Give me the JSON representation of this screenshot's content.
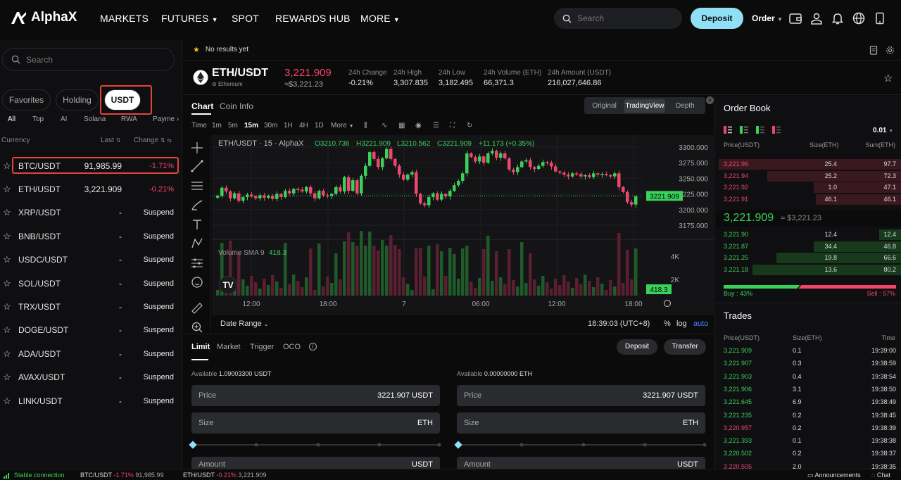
{
  "app": {
    "name": "AlphaX"
  },
  "nav": {
    "markets": "MARKETS",
    "futures": "FUTURES",
    "spot": "SPOT",
    "rewards": "REWARDS HUB",
    "more": "MORE",
    "search_placeholder": "Search",
    "deposit": "Deposit",
    "order": "Order"
  },
  "sidebar": {
    "search_placeholder": "Search",
    "pills": [
      "Favorites",
      "Holding",
      "USDT"
    ],
    "categories": [
      "All",
      "Top",
      "AI",
      "Solana",
      "RWA",
      "Payme"
    ],
    "col_currency": "Currency",
    "col_last": "Last",
    "col_change": "Change",
    "rows": [
      {
        "sym": "BTC/USDT",
        "last": "91,985.99",
        "change": "-1.71%"
      },
      {
        "sym": "ETH/USDT",
        "last": "3,221.909",
        "change": "-0.21%"
      },
      {
        "sym": "XRP/USDT",
        "last": "-",
        "change": "Suspend"
      },
      {
        "sym": "BNB/USDT",
        "last": "-",
        "change": "Suspend"
      },
      {
        "sym": "USDC/USDT",
        "last": "-",
        "change": "Suspend"
      },
      {
        "sym": "SOL/USDT",
        "last": "-",
        "change": "Suspend"
      },
      {
        "sym": "TRX/USDT",
        "last": "-",
        "change": "Suspend"
      },
      {
        "sym": "DOGE/USDT",
        "last": "-",
        "change": "Suspend"
      },
      {
        "sym": "ADA/USDT",
        "last": "-",
        "change": "Suspend"
      },
      {
        "sym": "AVAX/USDT",
        "last": "-",
        "change": "Suspend"
      },
      {
        "sym": "LINK/USDT",
        "last": "-",
        "change": "Suspend"
      }
    ]
  },
  "notice": {
    "text": "No results yet"
  },
  "ticker": {
    "pair": "ETH/USDT",
    "coin": "Ethereum",
    "price": "3,221.909",
    "price_fiat": "≈$3,221.23",
    "change_label": "24h Change",
    "change": "-0.21%",
    "high_label": "24h High",
    "high": "3,307.835",
    "low_label": "24h Low",
    "low": "3,182.495",
    "vol_label": "24h Volume (ETH)",
    "vol": "66,371.3",
    "amt_label": "24h Amount (USDT)",
    "amt": "216,027,646.86"
  },
  "chart_tabs": {
    "chart": "Chart",
    "coin_info": "Coin Info"
  },
  "view_modes": [
    "Original",
    "TradingView",
    "Depth"
  ],
  "timeframes": [
    "Time",
    "1m",
    "5m",
    "15m",
    "30m",
    "1H",
    "4H",
    "1D",
    "More"
  ],
  "chart": {
    "legend_pair": "ETH/USDT · 15 · AlphaX",
    "o": "O3210.736",
    "h": "H3221.909",
    "l": "L3210.562",
    "c": "C3221.909",
    "chg": "+11.173 (+0.35%)",
    "volume_label": "Volume SMA 9",
    "volume_val": "418.3",
    "price_ticks": [
      "3300.000",
      "3275.000",
      "3250.000",
      "3225.000",
      "3200.000",
      "3175.000"
    ],
    "last_tag": "3221.909",
    "vol_ticks": [
      "4K",
      "2K"
    ],
    "vol_tag": "418.3",
    "time_ticks": [
      "12:00",
      "18:00",
      "7",
      "06:00",
      "12:00",
      "18:00"
    ],
    "date_range": "Date Range",
    "clock": "18:39:03 (UTC+8)",
    "pct": "%",
    "log": "log",
    "auto": "auto"
  },
  "chart_data": {
    "type": "candlestick",
    "ylim": [
      3175,
      3300
    ],
    "last": 3221.909
  },
  "trade": {
    "tabs": [
      "Limit",
      "Market",
      "Trigger",
      "OCO"
    ],
    "deposit": "Deposit",
    "transfer": "Transfer",
    "buy_available_label": "Available",
    "buy_available": "1.09003300 USDT",
    "sell_available_label": "Available",
    "sell_available": "0.00000000 ETH",
    "price_label": "Price",
    "buy_price": "3221.907",
    "sell_price": "3221.907",
    "price_unit": "USDT",
    "size_label": "Size",
    "size_unit": "ETH",
    "amount_label": "Amount",
    "amount_unit": "USDT"
  },
  "orderbook": {
    "title": "Order Book",
    "tick": "0.01",
    "col_price": "Price(USDT)",
    "col_size": "Size(ETH)",
    "col_sum": "Sum(ETH)",
    "asks": [
      {
        "p": "3,221.96",
        "s": "25.4",
        "sum": "97.7",
        "depth": 0.98
      },
      {
        "p": "3,221.94",
        "s": "25.2",
        "sum": "72.3",
        "depth": 0.72
      },
      {
        "p": "3,221.92",
        "s": "1.0",
        "sum": "47.1",
        "depth": 0.47
      },
      {
        "p": "3,221.91",
        "s": "46.1",
        "sum": "46.1",
        "depth": 0.46
      }
    ],
    "mid": "3,221.909",
    "mid_fiat": "≈ $3,221.23",
    "bids": [
      {
        "p": "3,221.90",
        "s": "12.4",
        "sum": "12.4",
        "depth": 0.12
      },
      {
        "p": "3,221.87",
        "s": "34.4",
        "sum": "46.8",
        "depth": 0.47
      },
      {
        "p": "3,221.25",
        "s": "19.8",
        "sum": "66.6",
        "depth": 0.67
      },
      {
        "p": "3,221.18",
        "s": "13.6",
        "sum": "80.2",
        "depth": 0.8
      }
    ],
    "buy_label": "Buy : 43%",
    "sell_label": "Sell : 57%",
    "buy_pct": 0.43
  },
  "trades": {
    "title": "Trades",
    "col_price": "Price(USDT)",
    "col_size": "Size(ETH)",
    "col_time": "Time",
    "rows": [
      {
        "p": "3,221.909",
        "s": "0.1",
        "t": "19:39:00",
        "side": "buy"
      },
      {
        "p": "3,221.907",
        "s": "0.3",
        "t": "19:38:59",
        "side": "buy"
      },
      {
        "p": "3,221.903",
        "s": "0.4",
        "t": "19:38:54",
        "side": "buy"
      },
      {
        "p": "3,221.906",
        "s": "3.1",
        "t": "19:38:50",
        "side": "buy"
      },
      {
        "p": "3,221.645",
        "s": "6.9",
        "t": "19:38:49",
        "side": "buy"
      },
      {
        "p": "3,221.235",
        "s": "0.2",
        "t": "19:38:45",
        "side": "buy"
      },
      {
        "p": "3,220.957",
        "s": "0.2",
        "t": "19:38:39",
        "side": "sell"
      },
      {
        "p": "3,221.393",
        "s": "0.1",
        "t": "19:38:38",
        "side": "buy"
      },
      {
        "p": "3,220.502",
        "s": "0.2",
        "t": "19:38:37",
        "side": "buy"
      },
      {
        "p": "3,220.505",
        "s": "2.0",
        "t": "19:38:35",
        "side": "sell"
      }
    ]
  },
  "footer": {
    "connection": "Stable connection",
    "t1_sym": "BTC/USDT",
    "t1_chg": "-1.71%",
    "t1_price": "91,985.99",
    "t2_sym": "ETH/USDT",
    "t2_chg": "-0.21%",
    "t2_price": "3,221.909",
    "announcements": "Announcements",
    "chat": "Chat"
  },
  "colors": {
    "up": "#3ad15b",
    "down": "#f0466e",
    "accent": "#8fe0f5"
  }
}
